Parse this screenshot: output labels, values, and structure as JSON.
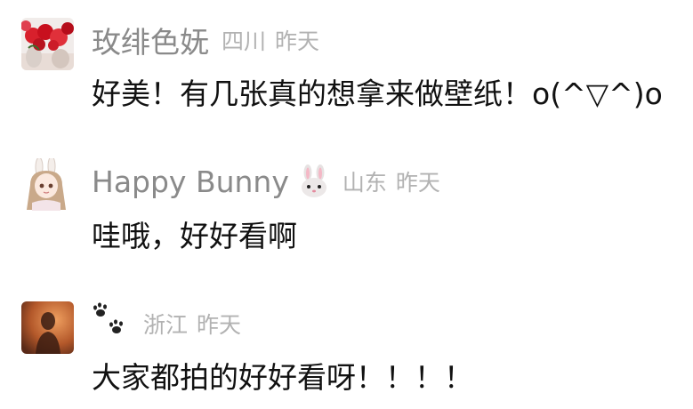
{
  "comments": [
    {
      "author": "玫绯色妩",
      "region": "四川",
      "time": "昨天",
      "text": "好美！有几张真的想拿来做壁纸！o(^▽^)o",
      "avatar_icon": "red-roses-avatar"
    },
    {
      "author": "Happy Bunny",
      "author_emoji": "rabbit-face-emoji",
      "region": "山东",
      "time": "昨天",
      "text": "哇哦，好好看啊",
      "avatar_icon": "bunny-girl-avatar"
    },
    {
      "author": "",
      "author_icon": "paw-prints-icon",
      "region": "浙江",
      "time": "昨天",
      "text": "大家都拍的好好看呀！！！！",
      "avatar_icon": "silhouette-orange-avatar"
    }
  ],
  "colors": {
    "name": "#8a8a8a",
    "meta": "#b2b2b2",
    "text": "#111111",
    "background": "#ffffff"
  }
}
